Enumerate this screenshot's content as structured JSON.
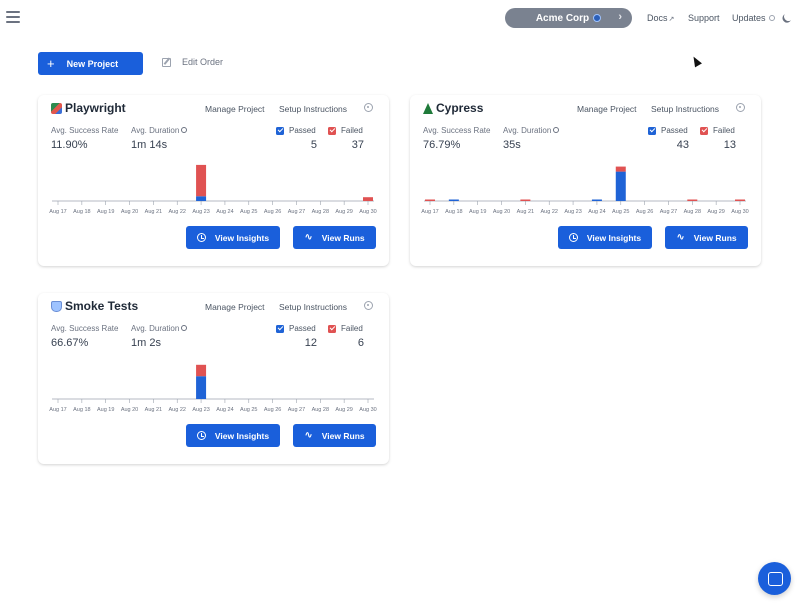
{
  "header": {
    "org_name": "Acme Corp",
    "links": [
      {
        "label": "Docs"
      },
      {
        "label": "Support"
      },
      {
        "label": "Updates"
      }
    ]
  },
  "toolbar": {
    "new_project_label": "New Project",
    "edit_order_label": "Edit Order"
  },
  "common": {
    "manage_project": "Manage Project",
    "setup_instructions": "Setup Instructions",
    "avg_success_rate": "Avg. Success Rate",
    "avg_duration": "Avg. Duration",
    "passed": "Passed",
    "failed": "Failed",
    "view_insights": "View Insights",
    "view_runs": "View Runs"
  },
  "colors": {
    "passed": "#1f63d6",
    "failed": "#e05252",
    "primary": "#1a5fdb"
  },
  "projects": [
    {
      "name": "Playwright",
      "icon": "theater-masks-icon",
      "success_rate": "11.90%",
      "duration": "1m 14s",
      "passed": "5",
      "failed": "37",
      "chart_data": {
        "type": "bar",
        "stacked": true,
        "categories": [
          "Aug 17",
          "Aug 18",
          "Aug 19",
          "Aug 20",
          "Aug 21",
          "Aug 22",
          "Aug 23",
          "Aug 24",
          "Aug 25",
          "Aug 26",
          "Aug 27",
          "Aug 28",
          "Aug 29",
          "Aug 30"
        ],
        "series": [
          {
            "name": "Passed",
            "values": [
              0,
              0,
              0,
              0,
              0,
              0,
              5,
              0,
              0,
              0,
              0,
              0,
              0,
              0
            ]
          },
          {
            "name": "Failed",
            "values": [
              0,
              0,
              0,
              0,
              0,
              0,
              33,
              0,
              0,
              0,
              0,
              0,
              0,
              4
            ]
          }
        ],
        "ylim": [
          0,
          40
        ]
      }
    },
    {
      "name": "Cypress",
      "icon": "evergreen-tree-icon",
      "success_rate": "76.79%",
      "duration": "35s",
      "passed": "43",
      "failed": "13",
      "chart_data": {
        "type": "bar",
        "stacked": true,
        "categories": [
          "Aug 17",
          "Aug 18",
          "Aug 19",
          "Aug 20",
          "Aug 21",
          "Aug 22",
          "Aug 23",
          "Aug 24",
          "Aug 25",
          "Aug 26",
          "Aug 27",
          "Aug 28",
          "Aug 29",
          "Aug 30"
        ],
        "series": [
          {
            "name": "Passed",
            "values": [
              0,
              1,
              0,
              0,
              0,
              0,
              0,
              1,
              41,
              0,
              0,
              0,
              0,
              0
            ]
          },
          {
            "name": "Failed",
            "values": [
              1,
              0,
              0,
              0,
              1,
              0,
              0,
              0,
              7,
              0,
              0,
              1,
              0,
              1
            ]
          }
        ],
        "ylim": [
          0,
          53
        ]
      }
    },
    {
      "name": "Smoke Tests",
      "icon": "shield-icon",
      "success_rate": "66.67%",
      "duration": "1m 2s",
      "passed": "12",
      "failed": "6",
      "chart_data": {
        "type": "bar",
        "stacked": true,
        "categories": [
          "Aug 17",
          "Aug 18",
          "Aug 19",
          "Aug 20",
          "Aug 21",
          "Aug 22",
          "Aug 23",
          "Aug 24",
          "Aug 25",
          "Aug 26",
          "Aug 27",
          "Aug 28",
          "Aug 29",
          "Aug 30"
        ],
        "series": [
          {
            "name": "Passed",
            "values": [
              0,
              0,
              0,
              0,
              0,
              0,
              12,
              0,
              0,
              0,
              0,
              0,
              0,
              0
            ]
          },
          {
            "name": "Failed",
            "values": [
              0,
              0,
              0,
              0,
              0,
              0,
              6,
              0,
              0,
              0,
              0,
              0,
              0,
              0
            ]
          }
        ],
        "ylim": [
          0,
          20
        ]
      }
    }
  ]
}
